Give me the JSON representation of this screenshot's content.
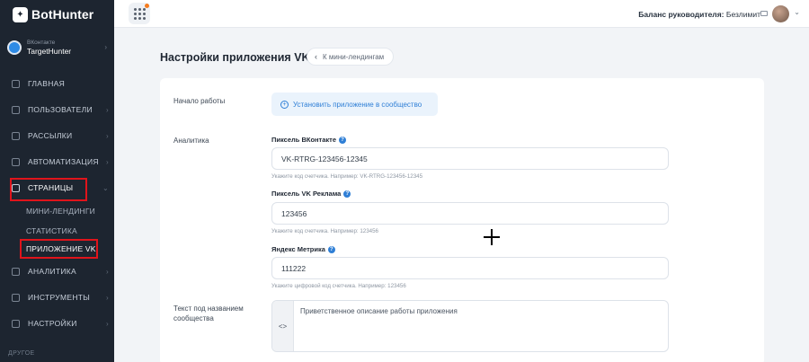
{
  "app": {
    "name": "BotHunter"
  },
  "account": {
    "network": "ВКонтакте",
    "name": "TargetHunter"
  },
  "sidebar": {
    "items": [
      {
        "label": "ГЛАВНАЯ"
      },
      {
        "label": "ПОЛЬЗОВАТЕЛИ"
      },
      {
        "label": "РАССЫЛКИ"
      },
      {
        "label": "АВТОМАТИЗАЦИЯ"
      },
      {
        "label": "СТРАНИЦЫ"
      },
      {
        "label": "АНАЛИТИКА"
      },
      {
        "label": "ИНСТРУМЕНТЫ"
      },
      {
        "label": "НАСТРОЙКИ"
      }
    ],
    "subitems": [
      {
        "label": "МИНИ-ЛЕНДИНГИ"
      },
      {
        "label": "СТАТИСТИКА"
      },
      {
        "label": "ПРИЛОЖЕНИЕ VK"
      }
    ],
    "section_other": "ДРУГОЕ"
  },
  "topbar": {
    "balance_label": "Баланс руководителя:",
    "balance_value": "Безлимит"
  },
  "page": {
    "title": "Настройки приложения VK",
    "back_label": "К мини-лендингам"
  },
  "form": {
    "start_label": "Начало работы",
    "install_button": "Установить приложение в сообщество",
    "analytics_label": "Аналитика",
    "pixel_vk": {
      "label": "Пиксель ВКонтакте",
      "value": "VK-RTRG-123456-12345",
      "hint": "Укажите код счетчика. Например: VK-RTRG-123456-12345"
    },
    "pixel_vk_ads": {
      "label": "Пиксель VK Реклама",
      "value": "123456",
      "hint": "Укажите код счетчика. Например: 123456"
    },
    "yandex_metrika": {
      "label": "Яндекс Метрика",
      "value": "111222",
      "hint": "Укажите цифровой код счетчика. Например: 123456"
    },
    "description_label_line1": "Текст под названием",
    "description_label_line2": "сообщества",
    "description_value": "Приветственное описание работы приложения",
    "code_toggle": "<>"
  },
  "colors": {
    "sidebar_bg": "#1d2530",
    "accent": "#2f7fd6",
    "highlight_box": "#e0141b"
  }
}
